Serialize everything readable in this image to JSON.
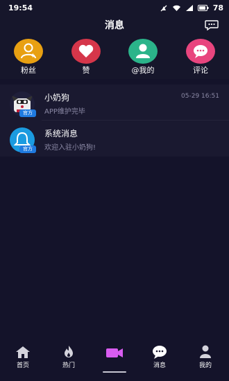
{
  "status_bar": {
    "time": "19:54",
    "battery": "78"
  },
  "header": {
    "title": "消息"
  },
  "quick_actions": [
    {
      "label": "粉丝",
      "icon": "fans-icon",
      "color": "#e8a012"
    },
    {
      "label": "赞",
      "icon": "heart-icon",
      "color": "#d5364a"
    },
    {
      "label": "@我的",
      "icon": "person-icon",
      "color": "#2bb48a"
    },
    {
      "label": "评论",
      "icon": "comment-icon",
      "color": "#e8457e"
    }
  ],
  "messages": [
    {
      "title": "小奶狗",
      "subtitle": "APP维护完毕",
      "time": "05-29 16:51",
      "badge": "官方",
      "icon": "mascot-avatar"
    },
    {
      "title": "系统消息",
      "subtitle": "欢迎入驻小奶狗!",
      "time": "",
      "badge": "官方",
      "icon": "bell-icon"
    }
  ],
  "tabs": [
    {
      "label": "首页",
      "icon": "home-icon"
    },
    {
      "label": "热门",
      "icon": "flame-icon"
    },
    {
      "label": "",
      "icon": "camera-icon",
      "color": "#d85cf0"
    },
    {
      "label": "消息",
      "icon": "message-icon"
    },
    {
      "label": "我的",
      "icon": "profile-icon"
    }
  ],
  "colors": {
    "background": "#14132a",
    "panel": "#1a1930",
    "muted_text": "#8c8aa6",
    "badge": "#1f7ae0"
  }
}
